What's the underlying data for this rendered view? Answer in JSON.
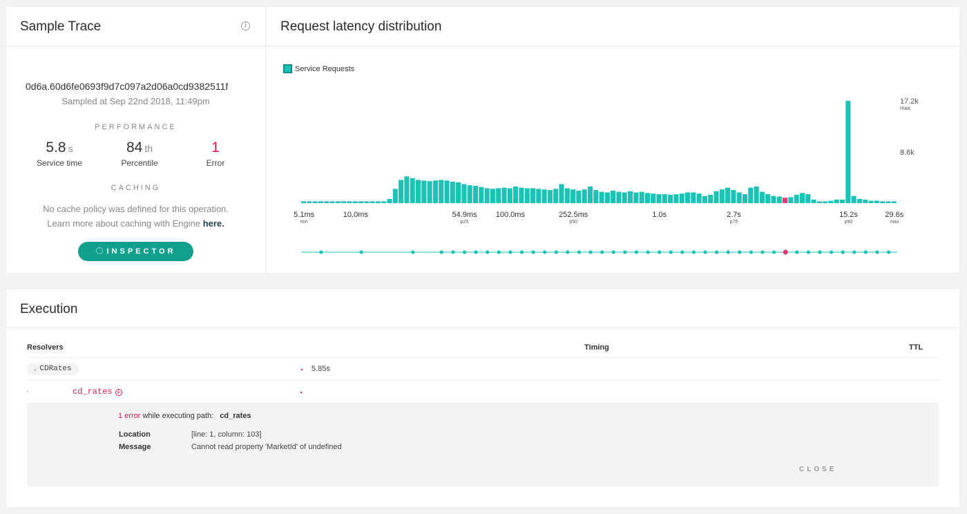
{
  "trace": {
    "title": "Sample Trace",
    "info_icon": "info-icon",
    "trace_id": "0d6a.60d6fe0693f9d7c097a2d06a0cd9382511f",
    "sampled_at": "Sampled at Sep 22nd 2018, 11:49pm",
    "performance_label": "PERFORMANCE",
    "stats": [
      {
        "value": "5.8",
        "unit": "s",
        "label": "Service time"
      },
      {
        "value": "84",
        "unit": "th",
        "label": "Percentile"
      },
      {
        "value": "1",
        "unit": "",
        "label": "Error"
      }
    ],
    "caching_label": "CACHING",
    "cache_line1": "No cache policy was defined for this operation.",
    "cache_line2": "Learn more about caching with Engine ",
    "cache_link": "here.",
    "inspector_label": "INSPECTOR"
  },
  "latency": {
    "title": "Request latency distribution",
    "legend": "Service Requests"
  },
  "chart_data": {
    "type": "bar",
    "legend": [
      "Service Requests"
    ],
    "y_ticks": [
      {
        "value": 17200,
        "label": "17.2k",
        "sub": "max"
      },
      {
        "value": 8600,
        "label": "8.6k",
        "sub": ""
      }
    ],
    "ylim": [
      0,
      17200
    ],
    "x_ticks": [
      {
        "bin": 0,
        "label": "5.1ms",
        "sub": "min"
      },
      {
        "bin": 9,
        "label": "10.0ms",
        "sub": ""
      },
      {
        "bin": 28,
        "label": "54.9ms",
        "sub": "p25"
      },
      {
        "bin": 36,
        "label": "100.0ms",
        "sub": ""
      },
      {
        "bin": 47,
        "label": "252.5ms",
        "sub": "p50"
      },
      {
        "bin": 62,
        "label": "1.0s",
        "sub": ""
      },
      {
        "bin": 75,
        "label": "2.7s",
        "sub": "p75"
      },
      {
        "bin": 95,
        "label": "15.2s",
        "sub": "p90"
      },
      {
        "bin": 103,
        "label": "29.6s",
        "sub": "max"
      }
    ],
    "highlight_bin": 84,
    "values": [
      300,
      300,
      300,
      300,
      300,
      300,
      300,
      300,
      300,
      300,
      300,
      300,
      300,
      300,
      300,
      700,
      2400,
      3900,
      4500,
      4200,
      3900,
      3800,
      3700,
      3800,
      3900,
      3800,
      3600,
      3500,
      3200,
      3000,
      2900,
      2700,
      2500,
      2400,
      2500,
      2600,
      2500,
      2800,
      2600,
      2500,
      2500,
      2400,
      2300,
      2200,
      2400,
      3200,
      2500,
      2300,
      2100,
      2300,
      2800,
      2200,
      1900,
      1800,
      2100,
      1900,
      1800,
      2000,
      1800,
      1900,
      1700,
      1600,
      1500,
      1500,
      1400,
      1500,
      1600,
      1800,
      1800,
      1600,
      1200,
      1400,
      2000,
      2300,
      2600,
      2200,
      1800,
      1500,
      2600,
      2800,
      1900,
      1500,
      1200,
      1100,
      900,
      1000,
      1400,
      1700,
      1500,
      600,
      300,
      300,
      400,
      600,
      600,
      17200,
      1200,
      700,
      600,
      400,
      400,
      300,
      300,
      300
    ]
  },
  "execution": {
    "title": "Execution",
    "col_resolvers": "Resolvers",
    "col_timing": "Timing",
    "col_ttl": "TTL",
    "root_resolver": "CDRates",
    "root_timing": "5.85s",
    "error_resolver": "cd_rates",
    "error_count": "1 error",
    "error_text": "while executing path:",
    "error_path": "cd_rates",
    "location_label": "Location",
    "location_value": "[line: 1, column: 103]",
    "message_label": "Message",
    "message_value": "Cannot read property 'MarketId' of undefined",
    "close_label": "CLOSE"
  },
  "colors": {
    "bar": "#1bc3b6",
    "highlight": "#e0367a",
    "accent": "#11a08c",
    "error": "#e0174d"
  }
}
